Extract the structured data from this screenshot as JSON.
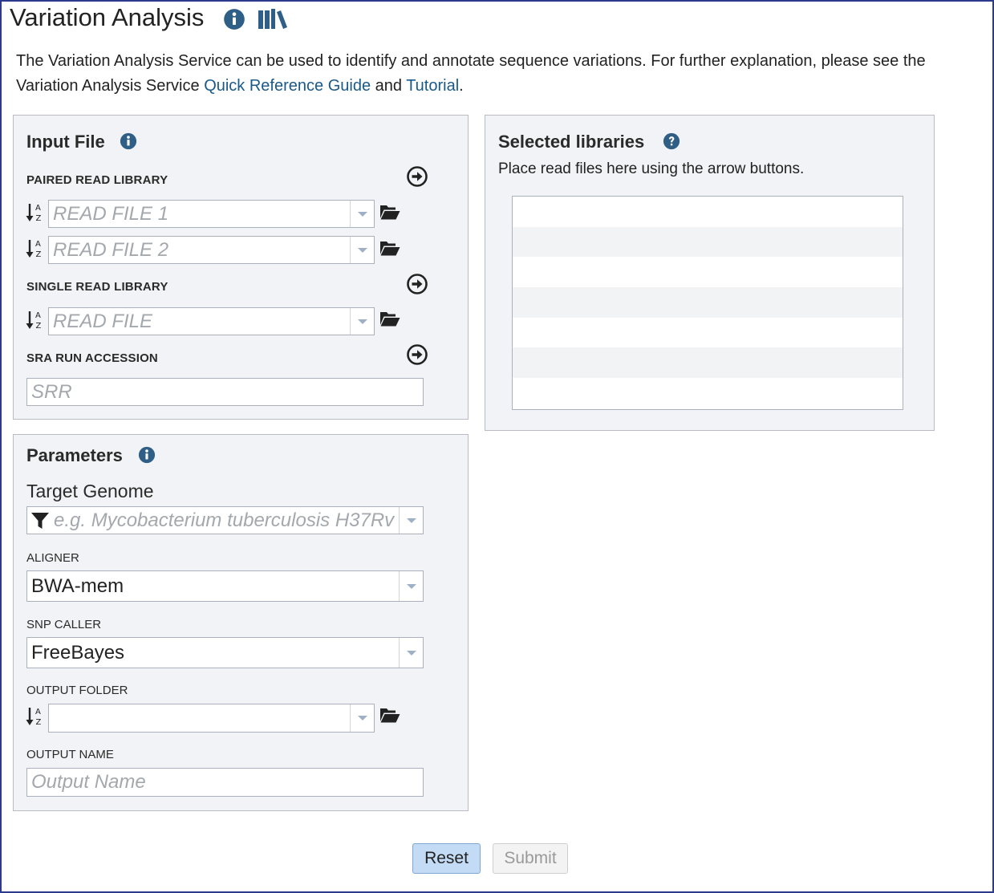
{
  "page": {
    "title": "Variation Analysis",
    "intro_text": "The Variation Analysis Service can be used to identify and annotate sequence variations. For further explanation, please see the Variation Analysis Service ",
    "quick_ref_link": "Quick Reference Guide",
    "and_text": " and ",
    "tutorial_link": "Tutorial",
    "period": "."
  },
  "input_file": {
    "title": "Input File",
    "paired_label": "PAIRED READ LIBRARY",
    "read_file1_placeholder": "READ FILE 1",
    "read_file2_placeholder": "READ FILE 2",
    "single_label": "SINGLE READ LIBRARY",
    "read_file_placeholder": "READ FILE",
    "sra_label": "SRA RUN ACCESSION",
    "sra_placeholder": "SRR"
  },
  "selected_libraries": {
    "title": "Selected libraries",
    "hint": "Place read files here using the arrow buttons."
  },
  "parameters": {
    "title": "Parameters",
    "target_genome_label": "Target Genome",
    "target_genome_placeholder": "e.g. Mycobacterium tuberculosis H37Rv",
    "aligner_label": "ALIGNER",
    "aligner_value": "BWA-mem",
    "snp_caller_label": "SNP CALLER",
    "snp_caller_value": "FreeBayes",
    "output_folder_label": "OUTPUT FOLDER",
    "output_folder_value": "",
    "output_name_label": "OUTPUT NAME",
    "output_name_placeholder": "Output Name"
  },
  "buttons": {
    "reset": "Reset",
    "submit": "Submit"
  },
  "colors": {
    "accent": "#2f5f86",
    "link": "#1a5a8a",
    "frame_border": "#2b3a8c",
    "reset_bg": "#c3dbf4"
  },
  "icons": [
    "info-icon",
    "library-icon",
    "help-icon",
    "sort-az-icon",
    "folder-open-icon",
    "arrow-circle-right-icon",
    "filter-icon",
    "chevron-down-icon"
  ]
}
